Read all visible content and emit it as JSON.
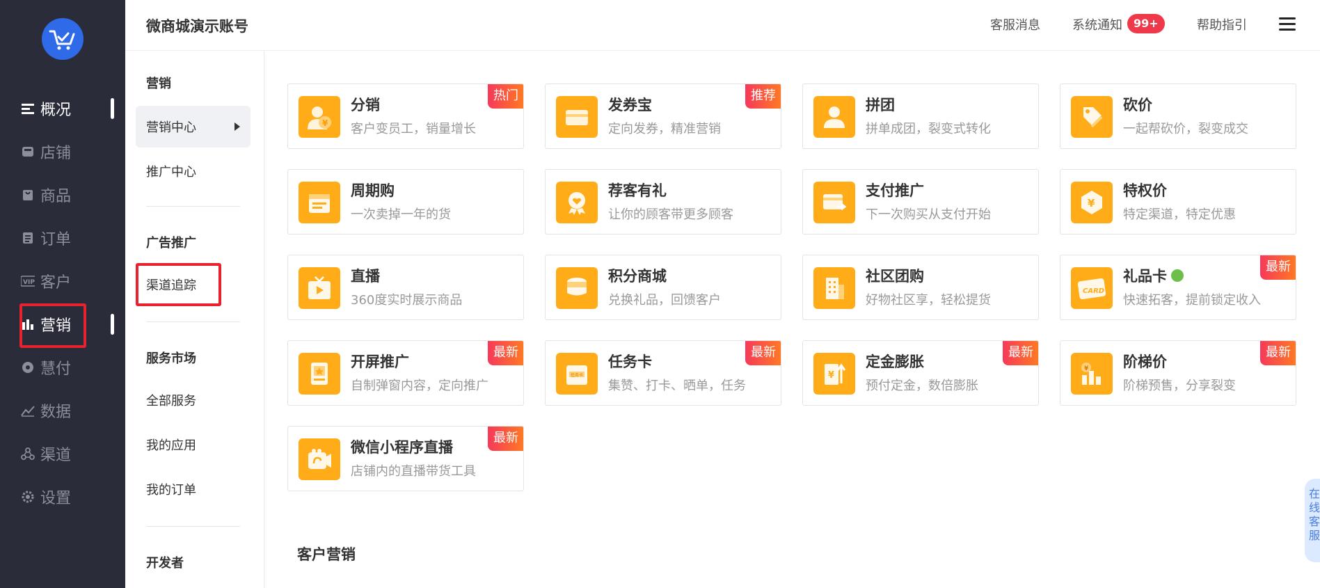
{
  "header": {
    "shop_title": "微商城演示账号",
    "customer_service": "客服消息",
    "system_notice": "系统通知",
    "notice_count": "99+",
    "help": "帮助指引"
  },
  "rail": {
    "items": [
      {
        "label": "概况",
        "icon": "overview-icon"
      },
      {
        "label": "店铺",
        "icon": "store-icon"
      },
      {
        "label": "商品",
        "icon": "goods-icon"
      },
      {
        "label": "订单",
        "icon": "order-icon"
      },
      {
        "label": "客户",
        "icon": "vip-icon"
      },
      {
        "label": "营销",
        "icon": "bar-chart-icon"
      },
      {
        "label": "慧付",
        "icon": "pay-icon"
      },
      {
        "label": "数据",
        "icon": "trend-icon"
      },
      {
        "label": "渠道",
        "icon": "channel-icon"
      },
      {
        "label": "设置",
        "icon": "gear-icon"
      }
    ]
  },
  "submenu": {
    "marketing_head": "营销",
    "marketing_center": "营销中心",
    "promotion_center": "推广中心",
    "ads_head": "广告推广",
    "channel_tracking": "渠道追踪",
    "service_head": "服务市场",
    "all_services": "全部服务",
    "my_apps": "我的应用",
    "my_orders": "我的订单",
    "developer_head": "开发者"
  },
  "cards": [
    {
      "title": "分销",
      "desc": "客户变员工，销量增长",
      "badge": "热门",
      "icon": "distribution-icon"
    },
    {
      "title": "发券宝",
      "desc": "定向发券，精准营销",
      "badge": "推荐",
      "icon": "coupon-icon"
    },
    {
      "title": "拼团",
      "desc": "拼单成团，裂变式转化",
      "badge": "",
      "icon": "group-buy-icon"
    },
    {
      "title": "砍价",
      "desc": "一起帮砍价，裂变成交",
      "badge": "",
      "icon": "bargain-icon"
    },
    {
      "title": "周期购",
      "desc": "一次卖掉一年的货",
      "badge": "",
      "icon": "calendar-icon"
    },
    {
      "title": "荐客有礼",
      "desc": "让你的顾客带更多顾客",
      "badge": "",
      "icon": "referral-icon"
    },
    {
      "title": "支付推广",
      "desc": "下一次购买从支付开始",
      "badge": "",
      "icon": "payment-promo-icon"
    },
    {
      "title": "特权价",
      "desc": "特定渠道，特定优惠",
      "badge": "",
      "icon": "privilege-price-icon"
    },
    {
      "title": "直播",
      "desc": "360度实时展示商品",
      "badge": "",
      "icon": "live-tv-icon"
    },
    {
      "title": "积分商城",
      "desc": "兑换礼品，回馈客户",
      "badge": "",
      "icon": "points-icon"
    },
    {
      "title": "社区团购",
      "desc": "好物社区享，轻松提货",
      "badge": "",
      "icon": "building-icon"
    },
    {
      "title": "礼品卡",
      "desc": "快速拓客，提前锁定收入",
      "badge": "最新",
      "icon": "gift-card-icon"
    },
    {
      "title": "开屏推广",
      "desc": "自制弹窗内容，定向推广",
      "badge": "最新",
      "icon": "splash-icon"
    },
    {
      "title": "任务卡",
      "desc": "集赞、打卡、晒单，任务",
      "badge": "最新",
      "icon": "task-card-icon"
    },
    {
      "title": "定金膨胀",
      "desc": "预付定金，数倍膨胀",
      "badge": "最新",
      "icon": "deposit-icon"
    },
    {
      "title": "阶梯价",
      "desc": "阶梯预售，分享裂变",
      "badge": "最新",
      "icon": "tier-price-icon"
    },
    {
      "title": "微信小程序直播",
      "desc": "店铺内的直播带货工具",
      "badge": "最新",
      "icon": "mini-live-icon"
    }
  ],
  "section_title": "客户营销",
  "online_service": "在线客服",
  "card_labels": {
    "gift_card_text": "CARD",
    "task_card_text": "任务卡"
  }
}
